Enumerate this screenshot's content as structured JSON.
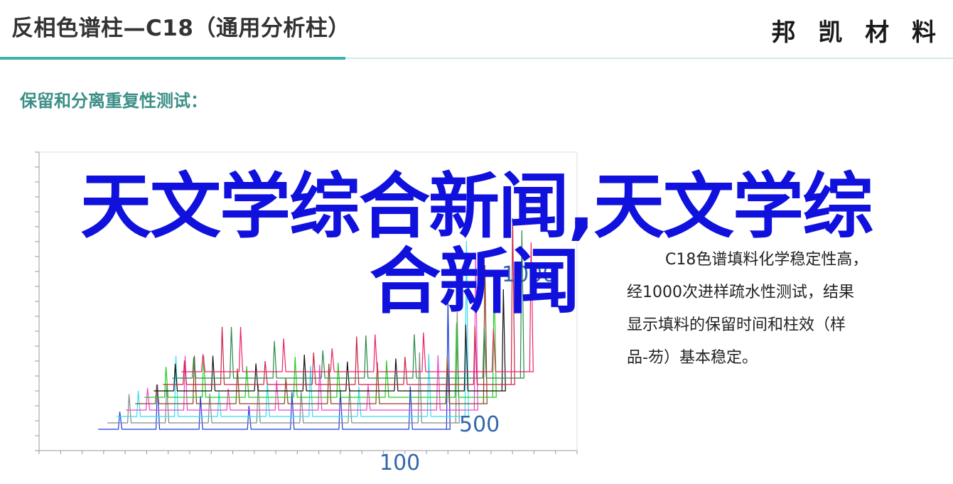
{
  "header": {
    "title": "反相色谱柱—C18（通用分析柱）",
    "brand": "邦 凯 材 料",
    "accent_color": "#3cb3a8"
  },
  "section": {
    "heading": "保留和分离重复性测试："
  },
  "description": {
    "lines": [
      "C18色谱填料化学稳定性高，",
      "经1000次进样疏水性测试，结果",
      "显示填料的保留时间和柱效（样",
      "品-芴）基本稳定。"
    ]
  },
  "overlay": {
    "line1": "天文学综合新闻,天文学综",
    "line2": "合新闻",
    "color": "#1111dd"
  },
  "chart_data": {
    "type": "line",
    "title": "",
    "xlabel": "",
    "ylabel": "",
    "annotations": [
      "1000",
      "500",
      "100"
    ],
    "series": [
      {
        "injection_index": 1,
        "color": "#1a3fd6",
        "peaks": [
          1.5,
          2.2,
          3.0,
          3.9,
          4.7,
          5.6,
          6.9,
          7.6
        ]
      },
      {
        "injection_index": 2,
        "color": "#888888",
        "peaks": [
          1.5,
          2.2,
          3.0,
          3.9,
          4.7,
          5.6,
          6.9,
          7.6
        ]
      },
      {
        "injection_index": 3,
        "color": "#33ddee",
        "peaks": [
          1.5,
          2.2,
          3.0,
          3.9,
          4.7,
          5.6,
          6.9,
          7.6
        ]
      },
      {
        "injection_index": 4,
        "color": "#ee44cc",
        "peaks": [
          1.5,
          2.2,
          3.0,
          3.9,
          4.7,
          5.6,
          6.9,
          7.6
        ]
      },
      {
        "injection_index": 5,
        "color": "#884422",
        "peaks": [
          1.5,
          2.2,
          3.0,
          3.9,
          4.7,
          5.6,
          6.9,
          7.6
        ]
      },
      {
        "injection_index": 6,
        "color": "#22cc22",
        "peaks": [
          1.5,
          2.2,
          3.0,
          3.9,
          4.7,
          5.6,
          6.9,
          7.6
        ]
      },
      {
        "injection_index": 7,
        "color": "#111111",
        "peaks": [
          1.5,
          2.2,
          3.0,
          3.9,
          4.7,
          5.6,
          6.9,
          7.6
        ]
      },
      {
        "injection_index": 8,
        "color": "#cc2244",
        "peaks": [
          1.5,
          2.2,
          3.0,
          3.9,
          4.7,
          5.6,
          6.9,
          7.6
        ]
      },
      {
        "injection_index": 9,
        "color": "#2a8a4a",
        "peaks": [
          1.5,
          2.2,
          3.0,
          3.9,
          4.7,
          5.6,
          6.9,
          7.6
        ]
      },
      {
        "injection_index": 10,
        "color": "#ee2266",
        "peaks": [
          1.5,
          2.2,
          3.0,
          3.9,
          4.7,
          5.6,
          6.9,
          7.6
        ]
      }
    ]
  }
}
